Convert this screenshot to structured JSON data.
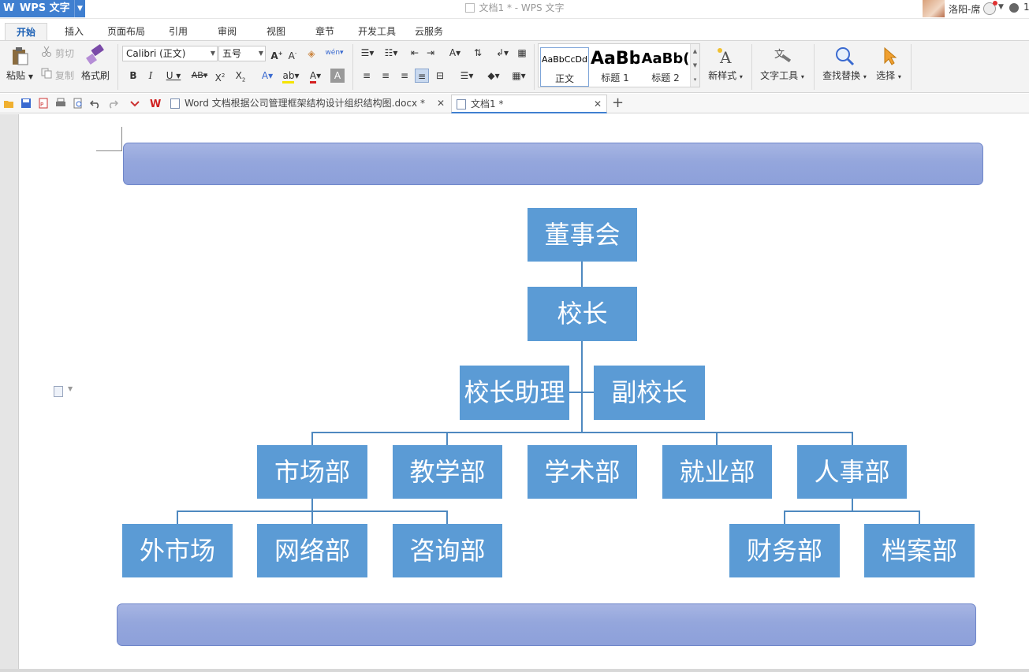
{
  "titlebar": {
    "app_name": "WPS 文字",
    "app_logo": "W",
    "document_title": "文档1 * - WPS 文字",
    "user_name": "洛阳-席",
    "edge_number": "1"
  },
  "ribbon_tabs": [
    "开始",
    "插入",
    "页面布局",
    "引用",
    "审阅",
    "视图",
    "章节",
    "开发工具",
    "云服务"
  ],
  "ribbon": {
    "paste": "粘贴",
    "cut": "剪切",
    "copy": "复制",
    "format_painter": "格式刷",
    "font_name": "Calibri (正文)",
    "font_size": "五号",
    "styles": [
      {
        "preview": "AaBbCcDd",
        "name": "正文"
      },
      {
        "preview": "AaBb",
        "name": "标题 1"
      },
      {
        "preview": "AaBb(",
        "name": "标题 2"
      }
    ],
    "new_style": "新样式",
    "text_tools": "文字工具",
    "find_replace": "查找替换",
    "select": "选择"
  },
  "doc_tabs": [
    {
      "title": "Word 文档根据公司管理框架结构设计组织结构图.docx *",
      "active": false
    },
    {
      "title": "文档1 *",
      "active": true
    }
  ],
  "org_chart": {
    "board": "董事会",
    "principal": "校长",
    "assistant": "校长助理",
    "vice_principal": "副校长",
    "departments": [
      "市场部",
      "教学部",
      "学术部",
      "就业部",
      "人事部"
    ],
    "market_subs": [
      "外市场",
      "网络部",
      "咨询部"
    ],
    "hr_subs": [
      "财务部",
      "档案部"
    ]
  },
  "colors": {
    "node_fill": "#5b9bd5",
    "connector": "#4f89c0",
    "banner_fill": "#94a6dc",
    "accent": "#3f7fd0"
  }
}
